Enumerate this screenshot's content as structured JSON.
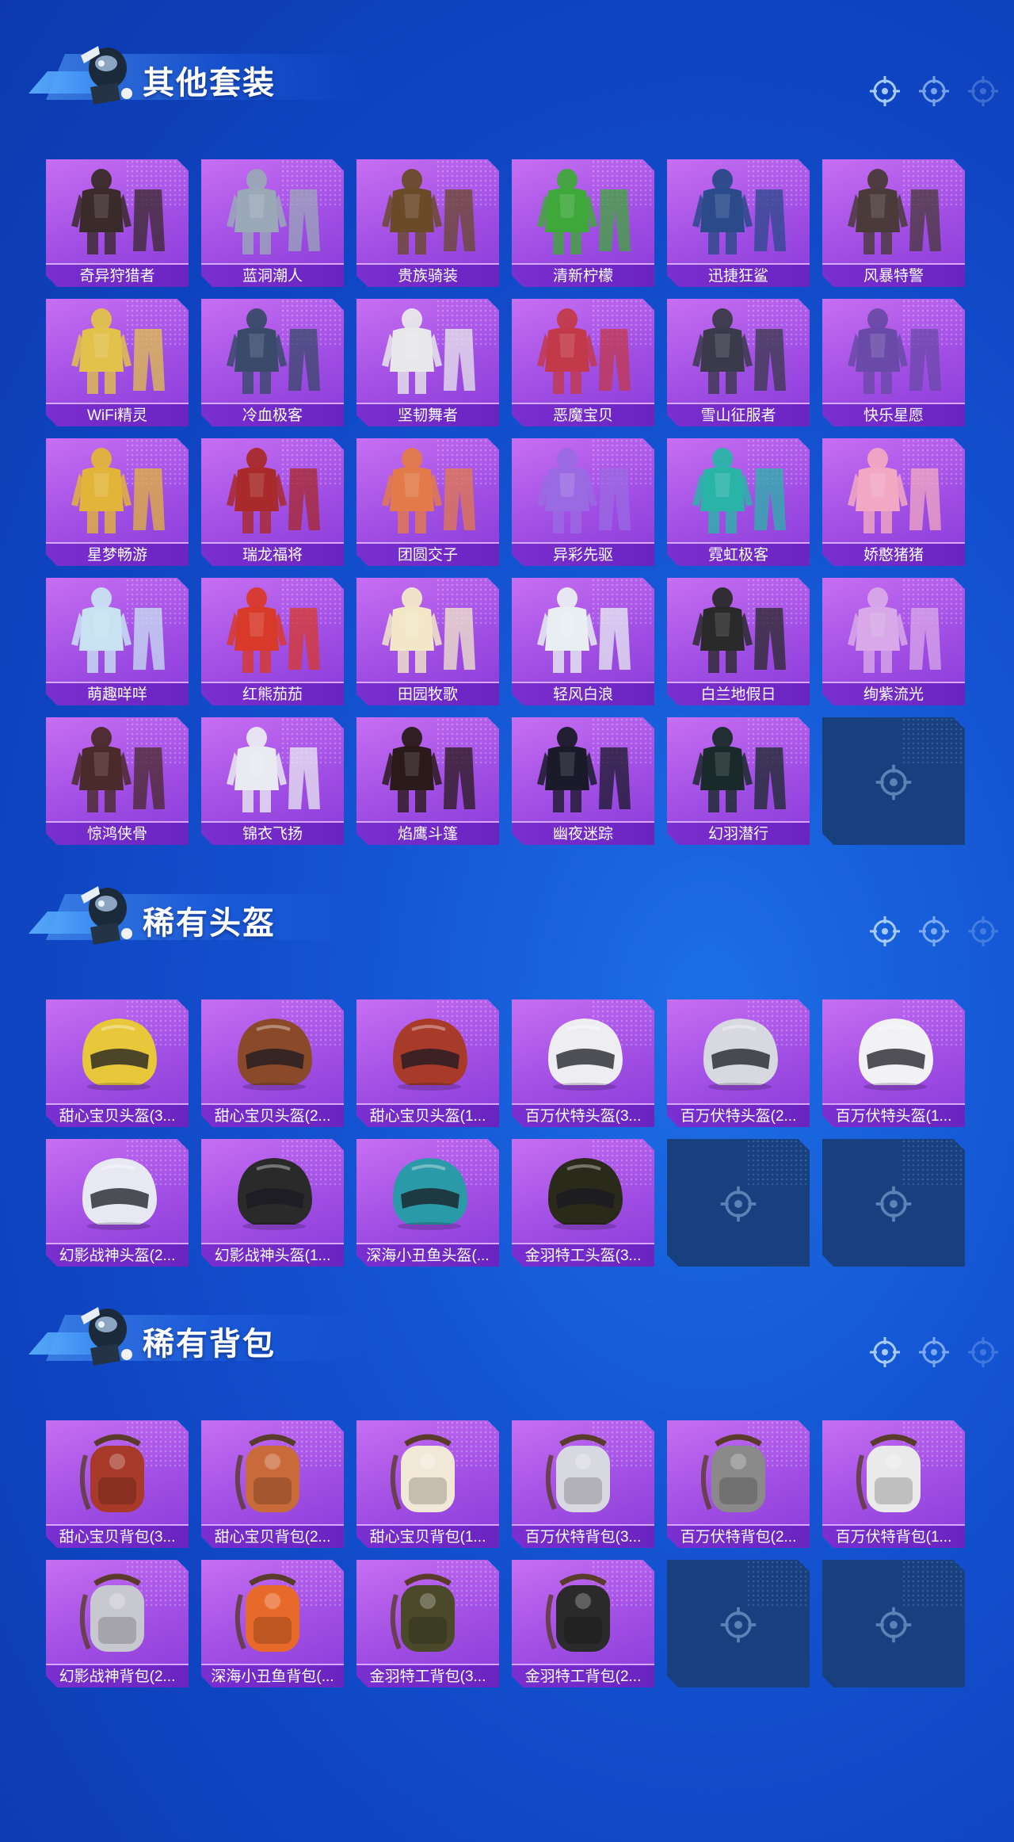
{
  "sections": [
    {
      "title": "其他套装",
      "items": [
        {
          "label": "奇异狩猎者",
          "color": "#3a2a2a"
        },
        {
          "label": "蓝洞潮人",
          "color": "#9aa8b8"
        },
        {
          "label": "贵族骑装",
          "color": "#6b4a2a"
        },
        {
          "label": "清新柠檬",
          "color": "#3fa83a"
        },
        {
          "label": "迅捷狂鲨",
          "color": "#2a4a8a"
        },
        {
          "label": "风暴特警",
          "color": "#4a3a3a"
        },
        {
          "label": "WiFi精灵",
          "color": "#e2c24a"
        },
        {
          "label": "冷血极客",
          "color": "#3a4a6a"
        },
        {
          "label": "坚韧舞者",
          "color": "#e8e8ea"
        },
        {
          "label": "恶魔宝贝",
          "color": "#c23a4a"
        },
        {
          "label": "雪山征服者",
          "color": "#3a3a4a"
        },
        {
          "label": "快乐星愿",
          "color": "#6a4aa8"
        },
        {
          "label": "星梦畅游",
          "color": "#e2b43a"
        },
        {
          "label": "瑞龙福将",
          "color": "#a82a2a"
        },
        {
          "label": "团圆交子",
          "color": "#e27a4a"
        },
        {
          "label": "异彩先驱",
          "color": "#9a6ae2"
        },
        {
          "label": "霓虹极客",
          "color": "#2ab4a8"
        },
        {
          "label": "娇憨猪猪",
          "color": "#f2a8c2"
        },
        {
          "label": "萌趣咩咩",
          "color": "#c8e2f2"
        },
        {
          "label": "红熊茄茄",
          "color": "#d83a2a"
        },
        {
          "label": "田园牧歌",
          "color": "#f2e8c8"
        },
        {
          "label": "轻风白浪",
          "color": "#e8eef2"
        },
        {
          "label": "白兰地假日",
          "color": "#2a2a2a"
        },
        {
          "label": "绚紫流光",
          "color": "#d8a8e8"
        },
        {
          "label": "惊鸿侠骨",
          "color": "#4a2a2a"
        },
        {
          "label": "锦衣飞扬",
          "color": "#eaeaf2"
        },
        {
          "label": "焰鹰斗篷",
          "color": "#2a1a1a"
        },
        {
          "label": "幽夜迷踪",
          "color": "#1a1a2a"
        },
        {
          "label": "幻羽潜行",
          "color": "#1a2a2a"
        },
        null
      ]
    },
    {
      "title": "稀有头盔",
      "items": [
        {
          "label": "甜心宝贝头盔(3...",
          "color": "#e8c83a"
        },
        {
          "label": "甜心宝贝头盔(2...",
          "color": "#8a4a2a"
        },
        {
          "label": "甜心宝贝头盔(1...",
          "color": "#a83a2a"
        },
        {
          "label": "百万伏特头盔(3...",
          "color": "#eeeef2"
        },
        {
          "label": "百万伏特头盔(2...",
          "color": "#d8d8e0"
        },
        {
          "label": "百万伏特头盔(1...",
          "color": "#f2f2f4"
        },
        {
          "label": "幻影战神头盔(2...",
          "color": "#e8e8f2"
        },
        {
          "label": "幻影战神头盔(1...",
          "color": "#2a2a2a"
        },
        {
          "label": "深海小丑鱼头盔(...",
          "color": "#2a9aa8"
        },
        {
          "label": "金羽特工头盔(3...",
          "color": "#2a2a1a"
        },
        null,
        null
      ]
    },
    {
      "title": "稀有背包",
      "items": [
        {
          "label": "甜心宝贝背包(3...",
          "color": "#a83a2a"
        },
        {
          "label": "甜心宝贝背包(2...",
          "color": "#c86a3a"
        },
        {
          "label": "甜心宝贝背包(1...",
          "color": "#f2e8d8"
        },
        {
          "label": "百万伏特背包(3...",
          "color": "#d8d8e0"
        },
        {
          "label": "百万伏特背包(2...",
          "color": "#8a8a8a"
        },
        {
          "label": "百万伏特背包(1...",
          "color": "#eaeaea"
        },
        {
          "label": "幻影战神背包(2...",
          "color": "#c8c8d0"
        },
        {
          "label": "深海小丑鱼背包(...",
          "color": "#e86a2a"
        },
        {
          "label": "金羽特工背包(3...",
          "color": "#4a4a2a"
        },
        {
          "label": "金羽特工背包(2...",
          "color": "#2a2a2a"
        },
        null,
        null
      ]
    }
  ]
}
